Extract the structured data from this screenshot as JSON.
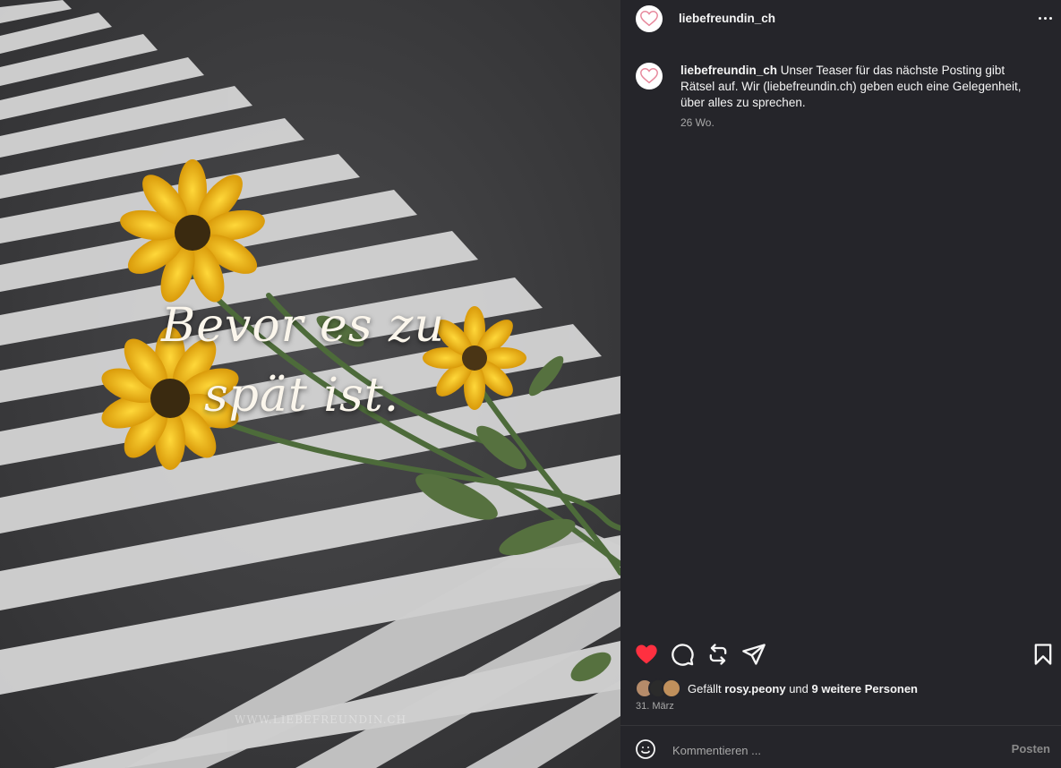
{
  "post": {
    "overlay_line1": "Bevor es zu",
    "overlay_line2": "spät ist.",
    "watermark": "WWW.LIEBEFREUNDIN.CH"
  },
  "header": {
    "username": "liebefreundin_ch",
    "more_icon": "more-horizontal-icon"
  },
  "caption": {
    "username": "liebefreundin_ch",
    "text": "Unser Teaser für das nächste Posting gibt Rätsel auf. Wir (liebefreundin.ch) geben euch eine Gelegenheit, über alles zu sprechen.",
    "time": "26 Wo."
  },
  "actions": {
    "icons": [
      "heart-filled-icon",
      "comment-icon",
      "repost-icon",
      "send-icon",
      "bookmark-icon"
    ],
    "like_color": "#ff3040"
  },
  "likes": {
    "prefix": "Gefällt ",
    "user": "rosy.peony",
    "middle": " und ",
    "others": "9 weitere Personen"
  },
  "date": "31. März",
  "comment": {
    "placeholder": "Kommentieren ...",
    "post_label": "Posten"
  },
  "colors": {
    "panel_bg": "#25252a",
    "text": "#f5f5f5",
    "muted": "#a8a8a8",
    "sunflower": "#f2c11a"
  }
}
